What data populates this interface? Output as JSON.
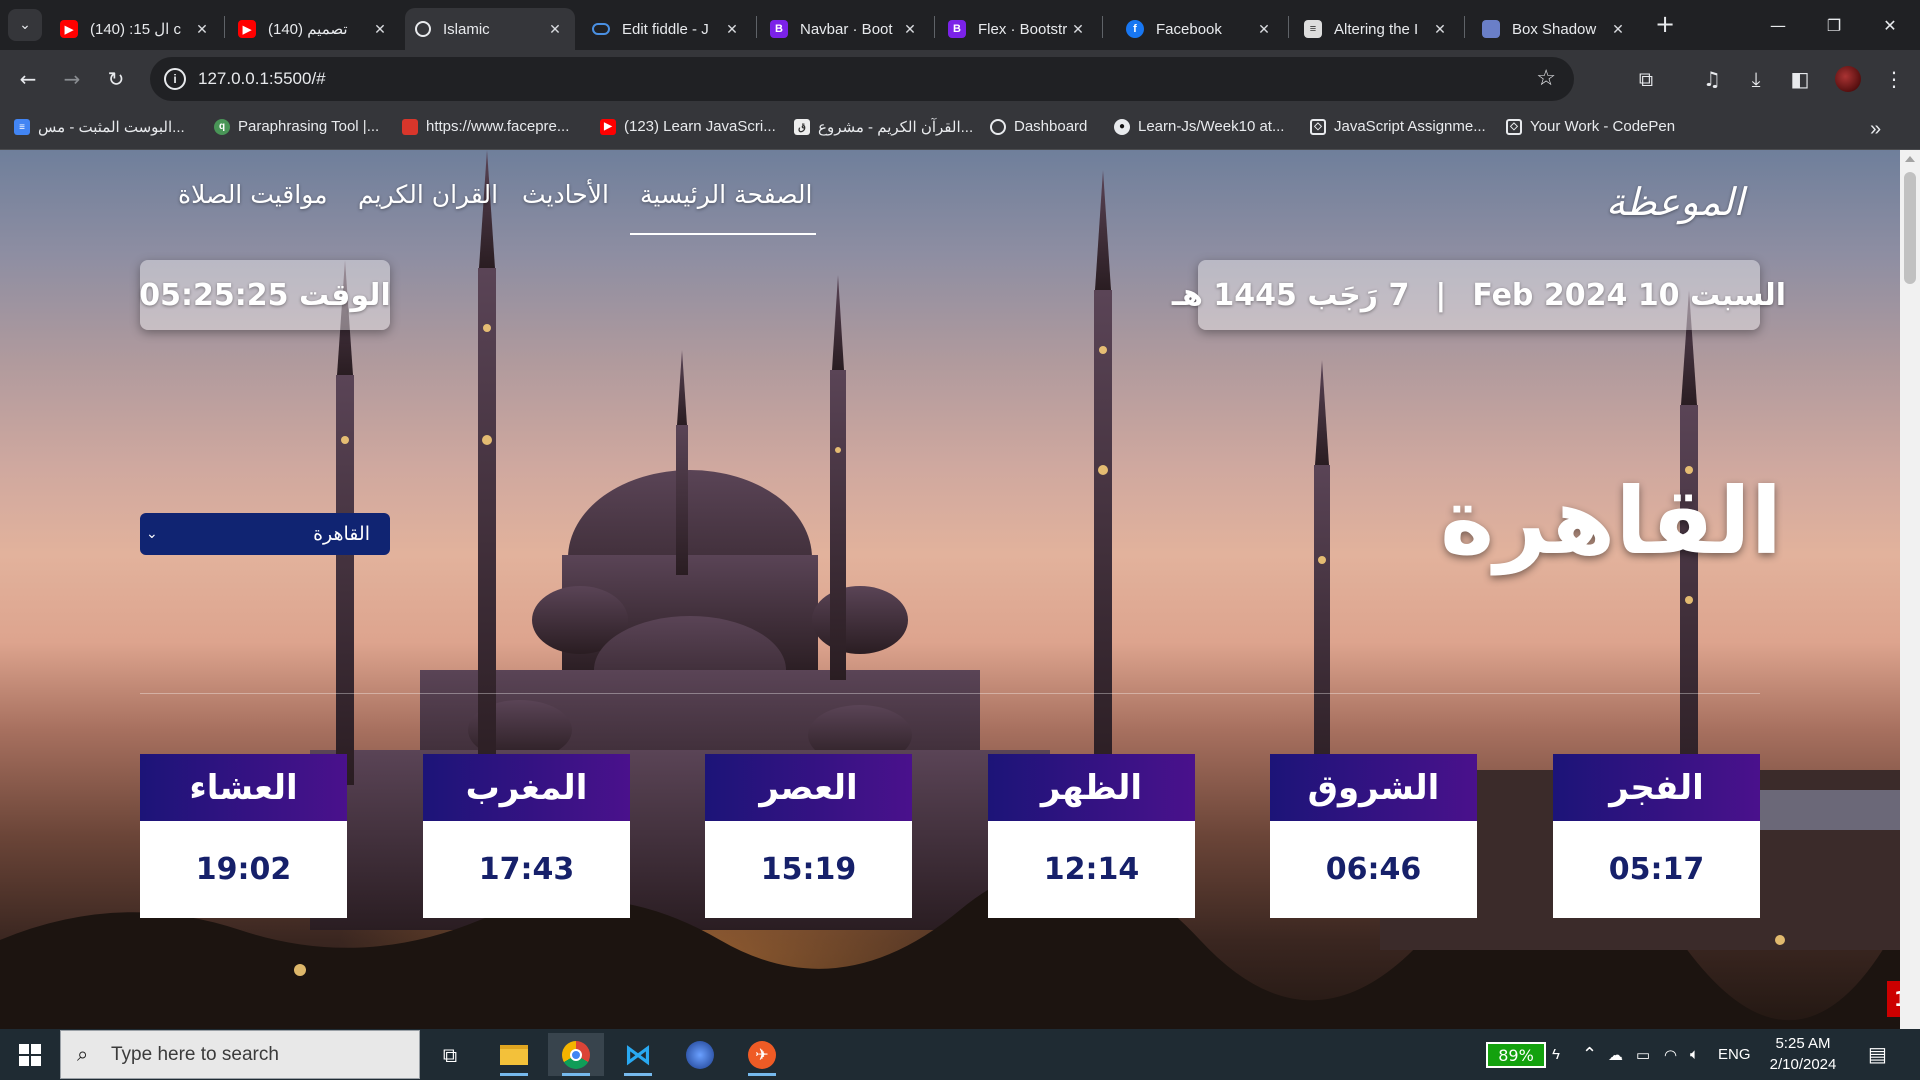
{
  "browser": {
    "tabs": [
      {
        "title": "(140) :15 ال c",
        "icon": "youtube-icon"
      },
      {
        "title": "(140) تصميم",
        "icon": "youtube-icon"
      },
      {
        "title": "Islamic",
        "icon": "globe-icon"
      },
      {
        "title": "Edit fiddle - J",
        "icon": "jsfiddle-icon"
      },
      {
        "title": "Navbar · Boot",
        "icon": "bootstrap-icon"
      },
      {
        "title": "Flex · Bootstr",
        "icon": "bootstrap-icon"
      },
      {
        "title": "Facebook",
        "icon": "facebook-icon"
      },
      {
        "title": "Altering the I",
        "icon": "document-icon"
      },
      {
        "title": "Box Shadow",
        "icon": "folder-icon"
      }
    ],
    "new_tab": "+",
    "url": "127.0.0.1:5500/#",
    "bookmarks": [
      {
        "label": "البوست المثبت - مس...",
        "icon": "docs-icon"
      },
      {
        "label": "Paraphrasing Tool |...",
        "icon": "quillbot-icon"
      },
      {
        "label": "https://www.facepre...",
        "icon": "faceprep-icon"
      },
      {
        "label": "(123) Learn JavaScri...",
        "icon": "youtube-icon"
      },
      {
        "label": "القرآن الكريم - مشروع...",
        "icon": "page-icon"
      },
      {
        "label": "Dashboard",
        "icon": "globe-icon"
      },
      {
        "label": "Learn-Js/Week10 at...",
        "icon": "github-icon"
      },
      {
        "label": "JavaScript Assignme...",
        "icon": "codepen-icon"
      },
      {
        "label": "Your Work - CodePen",
        "icon": "codepen-icon"
      }
    ]
  },
  "page": {
    "logo": "الموعظة",
    "nav": {
      "home": "الصفحة الرئيسية",
      "hadith": "الأحاديث",
      "quran": "القران الكريم",
      "prayer_times": "مواقيت الصلاة"
    },
    "date": "السبت 10 Feb 2024",
    "separator": "|",
    "hijri": "7 رَجَب 1445 هـ",
    "time": "الوقت 05:25:25",
    "city": "القاهرة",
    "city_select": "القاهرة",
    "prayers": [
      {
        "name": "الفجر",
        "time": "05:17"
      },
      {
        "name": "الشروق",
        "time": "06:46"
      },
      {
        "name": "الظهر",
        "time": "12:14"
      },
      {
        "name": "العصر",
        "time": "15:19"
      },
      {
        "name": "المغرب",
        "time": "17:43"
      },
      {
        "name": "العشاء",
        "time": "19:02"
      }
    ],
    "corner_badge": "1"
  },
  "taskbar": {
    "search_placeholder": "Type here to search",
    "battery": "89%",
    "language": "ENG",
    "time": "5:25 AM",
    "date": "2/10/2024"
  },
  "colors": {
    "card_header_start": "#1c1478",
    "card_header_end": "#4a118c",
    "card_time_text": "#16206a",
    "select_bg": "#102472",
    "battery_green": "#13a10e"
  }
}
